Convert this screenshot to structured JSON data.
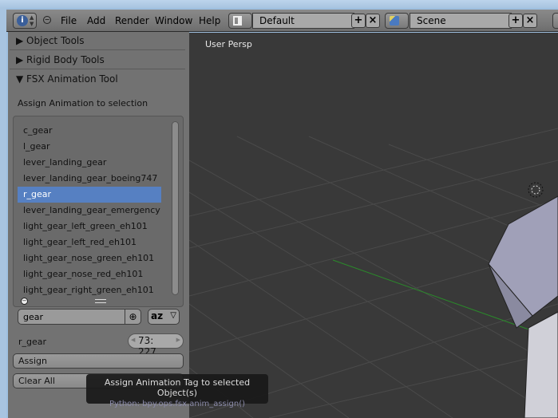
{
  "header": {
    "menus": [
      "File",
      "Add",
      "Render",
      "Window",
      "Help"
    ],
    "screen_layout": "Default",
    "scene": "Scene"
  },
  "panel": {
    "sections": [
      {
        "label": "Object Tools",
        "expanded": false
      },
      {
        "label": "Rigid Body Tools",
        "expanded": false
      },
      {
        "label": "FSX Animation Tool",
        "expanded": true
      }
    ],
    "assign_label": "Assign Animation to selection",
    "list": [
      "c_gear",
      "l_gear",
      "lever_landing_gear",
      "lever_landing_gear_boeing747",
      "r_gear",
      "lever_landing_gear_emergency",
      "light_gear_left_green_eh101",
      "light_gear_left_red_eh101",
      "light_gear_nose_green_eh101",
      "light_gear_nose_red_eh101",
      "light_gear_right_green_eh101"
    ],
    "selected_index": 4,
    "filter_value": "gear",
    "selected_name": "r_gear",
    "frame_range": "73: 227",
    "assign_button": "Assign",
    "clear_button": "Clear All"
  },
  "viewport": {
    "label": "User Persp",
    "grid_color": "#4b4b4b",
    "x_axis_color": "#2a8a2a"
  },
  "tooltip": {
    "title": "Assign Animation Tag to selected Object(s)",
    "python": "Python: bpy.ops.fsx.anim_assign()"
  },
  "colors": {
    "selection": "#5680c2",
    "panel": "#727272",
    "viewport": "#393939"
  }
}
